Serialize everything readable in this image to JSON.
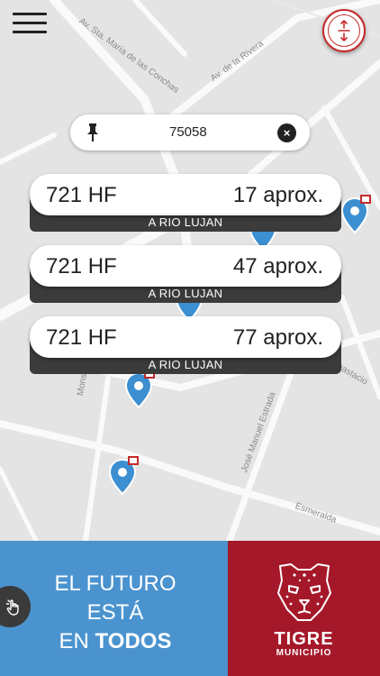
{
  "map": {
    "streets": [
      "Av. Sta. María de las Conchas",
      "Av. de la Rivera",
      "Anastacio",
      "José Manuel Estrada",
      "Esmeralda",
      "Mons"
    ]
  },
  "stop_search": {
    "stop_code": "75058"
  },
  "arrivals": [
    {
      "line": "721 HF",
      "eta": "17 aprox.",
      "destination": "A RIO LUJAN"
    },
    {
      "line": "721 HF",
      "eta": "47 aprox.",
      "destination": "A RIO LUJAN"
    },
    {
      "line": "721 HF",
      "eta": "77 aprox.",
      "destination": "A RIO LUJAN"
    }
  ],
  "banner": {
    "slogan_line1": "EL FUTURO",
    "slogan_line2": "ESTÁ",
    "slogan_line3_prefix": "EN ",
    "slogan_line3_bold": "TODOS",
    "brand_name": "TIGRE",
    "brand_sub": "MUNICIPIO"
  },
  "colors": {
    "accent_red": "#c62a2a",
    "marker_blue": "#3c8fd0",
    "banner_blue": "#4a93cf",
    "banner_red": "#a5182a",
    "card_dark": "#3b3b3b"
  },
  "icons": {
    "menu": "hamburger-icon",
    "expand": "expand-vertical-icon",
    "stop": "pushpin-icon",
    "clear": "close-icon",
    "marker": "bus-stop-marker-icon",
    "accessibility": "hand-touch-icon",
    "logo": "jaguar-logo"
  }
}
